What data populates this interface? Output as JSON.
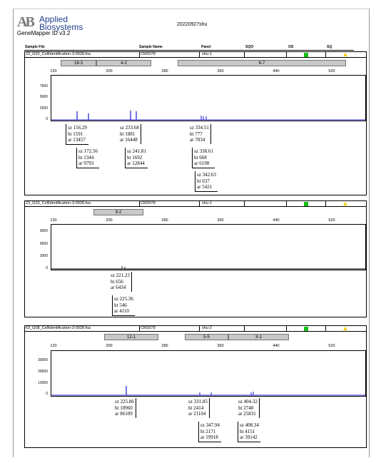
{
  "header": {
    "company_line1": "Applied",
    "company_line2": "Biosystems",
    "logo_mark": "AB",
    "app_name": "GeneMapper ID v3.2",
    "doc_title": "20220927shu"
  },
  "columns": {
    "sample_file": "Sample File",
    "sample_name": "Sample Name",
    "panel": "Panel",
    "sqo": "SQO",
    "os": "OS",
    "sq": "SQ"
  },
  "colors": {
    "trace": "#1a1ad0",
    "os": "#18c018",
    "sq": "#f0d000",
    "bin": "#c8c8c8"
  },
  "panels": [
    {
      "file": "23_G03_CellIdentification-3-0928.fsa",
      "sample_name": "CM3078",
      "panel": "shu-1",
      "bins": [
        {
          "label": "18-3"
        },
        {
          "label": "4-2"
        },
        {
          "label": "6-7"
        }
      ],
      "x_ticks": [
        "120",
        "200",
        "280",
        "360",
        "440",
        "520"
      ],
      "y_ticks": [
        "7500",
        "5000",
        "2500",
        "0"
      ],
      "labels": [
        {
          "lines": [
            "sz 156.29",
            "ht 1591",
            "ar 13457"
          ]
        },
        {
          "lines": [
            "sz 172.56",
            "ht 1344",
            "ar 9793"
          ]
        },
        {
          "lines": [
            "sz 233.68",
            "ht 1881",
            "ar 16448"
          ]
        },
        {
          "lines": [
            "sz 241.81",
            "ht 1692",
            "ar 12844"
          ]
        },
        {
          "lines": [
            "sz 334.51",
            "ht 777",
            "ar 7034"
          ]
        },
        {
          "lines": [
            "sz 338.61",
            "ht 668",
            "ar 6198"
          ]
        },
        {
          "lines": [
            "sz 342.63",
            "ht 637",
            "ar 5421"
          ]
        }
      ]
    },
    {
      "file": "23_G03_CellIdentification-3-0928.fsa",
      "sample_name": "CM3078",
      "panel": "shu-1",
      "bins": [
        {
          "label": "9-2"
        }
      ],
      "x_ticks": [
        "120",
        "200",
        "280",
        "360",
        "440",
        "520"
      ],
      "y_ticks": [
        "9000",
        "6000",
        "3000",
        "0"
      ],
      "labels": [
        {
          "lines": [
            "sz 221.23",
            "ht 656",
            "ar 6434"
          ]
        },
        {
          "lines": [
            "sz 225.36",
            "ht 546",
            "ar 4110"
          ]
        }
      ]
    },
    {
      "file": "63_G08_CellIdentification-3-0928.fsa",
      "sample_name": "CM3078",
      "panel": "shu-2",
      "bins": [
        {
          "label": "12-1"
        },
        {
          "label": "5-5"
        },
        {
          "label": "X-1"
        }
      ],
      "x_ticks": [
        "120",
        "200",
        "280",
        "360",
        "440",
        "520"
      ],
      "y_ticks": [
        "39000",
        "26000",
        "13000",
        "0"
      ],
      "labels": [
        {
          "lines": [
            "sz 225.86",
            "ht 10960",
            "ar 86109"
          ]
        },
        {
          "lines": [
            "sz 331.85",
            "ht 2414",
            "ar 21104"
          ]
        },
        {
          "lines": [
            "sz 404.32",
            "ht 2748",
            "ar 25831"
          ]
        },
        {
          "lines": [
            "sz 347.94",
            "ht 2171",
            "ar 19918"
          ]
        },
        {
          "lines": [
            "sz 408.34",
            "ht 4151",
            "ar 39142"
          ]
        }
      ]
    }
  ]
}
